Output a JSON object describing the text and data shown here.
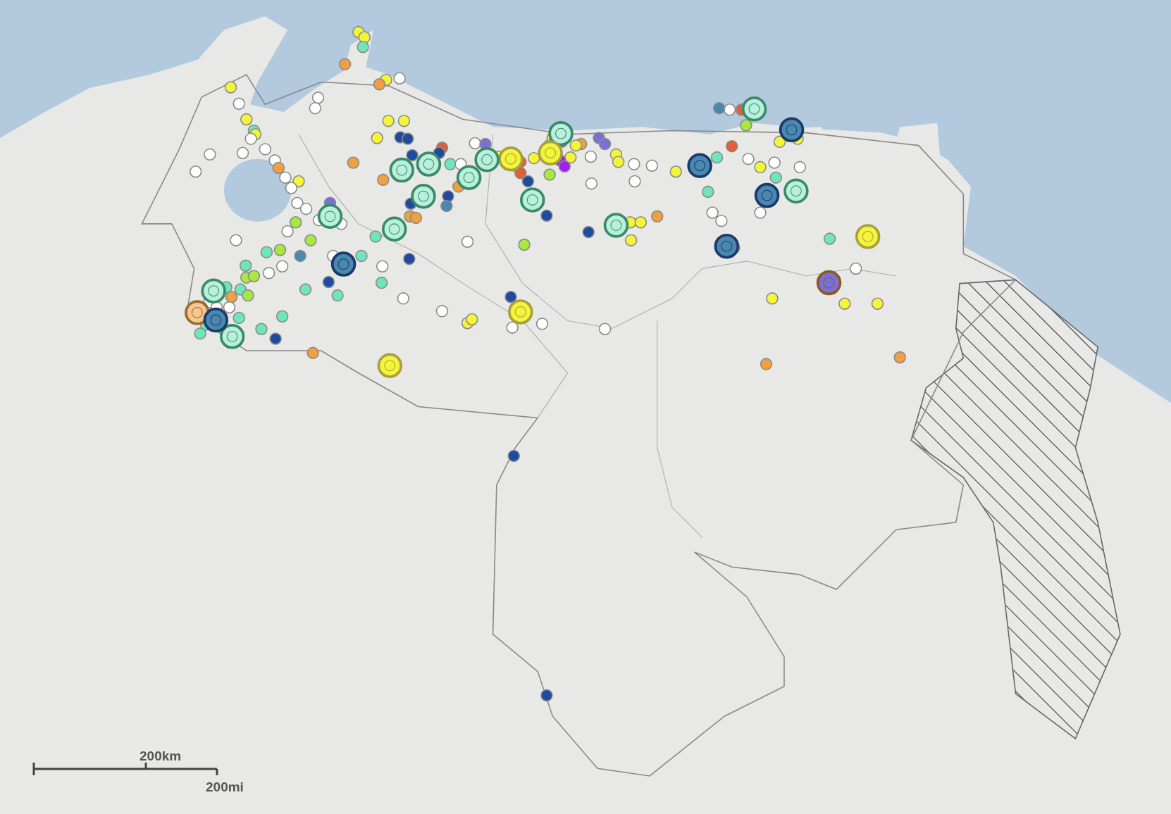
{
  "scale_bar": {
    "metric_label": "200km",
    "imperial_label": "200mi"
  }
}
